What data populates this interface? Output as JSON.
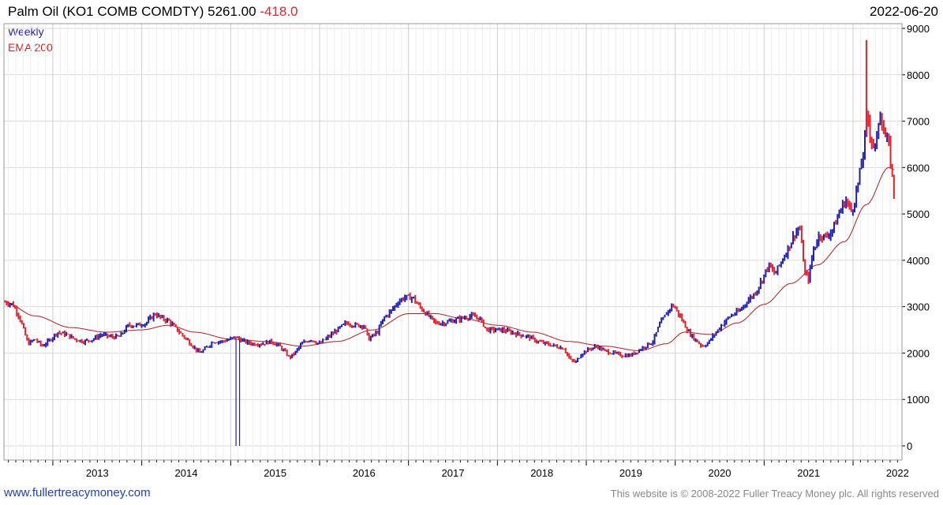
{
  "header": {
    "title": "Palm Oil (KO1 COMB COMDTY) 5261.00",
    "change": "-418.0",
    "date": "2022-06-20"
  },
  "legend": {
    "series1": "Weekly",
    "series2": "EMA 200"
  },
  "footer": {
    "left": "www.fullertreacymoney.com",
    "right": "This website is © 2008-2022 Fuller Treacy Money plc. All rights reserved"
  },
  "colors": {
    "up": "#1f1fb3",
    "down": "#e8202a",
    "ema": "#b01e22",
    "grid": "#d9d9d9",
    "axis": "#000000"
  },
  "chart_data": {
    "type": "line",
    "series_style": "weekly bar (OHLC) chart with moving average",
    "x_tick_labels": [
      "2013",
      "2014",
      "2015",
      "2016",
      "2017",
      "2018",
      "2019",
      "2020",
      "2021",
      "2022"
    ],
    "y_tick_labels": [
      "0",
      "1000",
      "2000",
      "3000",
      "4000",
      "5000",
      "6000",
      "7000",
      "8000",
      "9000"
    ],
    "ylim": [
      0,
      9000
    ],
    "xlim": [
      2012.45,
      2022.55
    ],
    "grid": true,
    "y_axis_side": "right",
    "series": [
      {
        "name": "Weekly",
        "points": [
          [
            2012.46,
            3100
          ],
          [
            2012.55,
            3050
          ],
          [
            2012.62,
            2800
          ],
          [
            2012.68,
            2450
          ],
          [
            2012.72,
            2200
          ],
          [
            2012.8,
            2300
          ],
          [
            2012.88,
            2150
          ],
          [
            2012.95,
            2250
          ],
          [
            2013.05,
            2450
          ],
          [
            2013.15,
            2400
          ],
          [
            2013.25,
            2300
          ],
          [
            2013.35,
            2250
          ],
          [
            2013.45,
            2300
          ],
          [
            2013.55,
            2400
          ],
          [
            2013.65,
            2350
          ],
          [
            2013.75,
            2350
          ],
          [
            2013.85,
            2600
          ],
          [
            2013.95,
            2600
          ],
          [
            2014.05,
            2650
          ],
          [
            2014.15,
            2850
          ],
          [
            2014.22,
            2750
          ],
          [
            2014.3,
            2700
          ],
          [
            2014.4,
            2500
          ],
          [
            2014.5,
            2300
          ],
          [
            2014.6,
            2100
          ],
          [
            2014.65,
            2000
          ],
          [
            2014.72,
            2100
          ],
          [
            2014.8,
            2250
          ],
          [
            2014.9,
            2250
          ],
          [
            2015.0,
            2300
          ],
          [
            2015.05,
            2350
          ],
          [
            2015.15,
            2250
          ],
          [
            2015.25,
            2200
          ],
          [
            2015.35,
            2200
          ],
          [
            2015.45,
            2250
          ],
          [
            2015.55,
            2150
          ],
          [
            2015.62,
            2000
          ],
          [
            2015.66,
            1900
          ],
          [
            2015.72,
            2000
          ],
          [
            2015.8,
            2200
          ],
          [
            2015.9,
            2300
          ],
          [
            2016.0,
            2200
          ],
          [
            2016.1,
            2350
          ],
          [
            2016.2,
            2500
          ],
          [
            2016.3,
            2650
          ],
          [
            2016.4,
            2600
          ],
          [
            2016.5,
            2600
          ],
          [
            2016.55,
            2300
          ],
          [
            2016.65,
            2450
          ],
          [
            2016.72,
            2750
          ],
          [
            2016.8,
            2900
          ],
          [
            2016.88,
            3100
          ],
          [
            2016.95,
            3200
          ],
          [
            2017.05,
            3200
          ],
          [
            2017.1,
            3050
          ],
          [
            2017.2,
            2850
          ],
          [
            2017.3,
            2650
          ],
          [
            2017.4,
            2650
          ],
          [
            2017.5,
            2700
          ],
          [
            2017.6,
            2750
          ],
          [
            2017.7,
            2800
          ],
          [
            2017.8,
            2750
          ],
          [
            2017.88,
            2500
          ],
          [
            2017.95,
            2500
          ],
          [
            2018.05,
            2500
          ],
          [
            2018.15,
            2450
          ],
          [
            2018.25,
            2400
          ],
          [
            2018.35,
            2350
          ],
          [
            2018.45,
            2250
          ],
          [
            2018.55,
            2200
          ],
          [
            2018.65,
            2150
          ],
          [
            2018.75,
            2100
          ],
          [
            2018.82,
            1850
          ],
          [
            2018.88,
            1800
          ],
          [
            2018.95,
            2000
          ],
          [
            2019.05,
            2100
          ],
          [
            2019.12,
            2150
          ],
          [
            2019.2,
            2050
          ],
          [
            2019.3,
            2000
          ],
          [
            2019.4,
            1950
          ],
          [
            2019.5,
            1950
          ],
          [
            2019.58,
            2050
          ],
          [
            2019.66,
            2150
          ],
          [
            2019.75,
            2250
          ],
          [
            2019.82,
            2600
          ],
          [
            2019.9,
            2850
          ],
          [
            2019.97,
            3050
          ],
          [
            2020.02,
            2900
          ],
          [
            2020.08,
            2700
          ],
          [
            2020.15,
            2450
          ],
          [
            2020.22,
            2300
          ],
          [
            2020.3,
            2150
          ],
          [
            2020.36,
            2200
          ],
          [
            2020.44,
            2400
          ],
          [
            2020.52,
            2600
          ],
          [
            2020.62,
            2800
          ],
          [
            2020.72,
            2900
          ],
          [
            2020.8,
            3100
          ],
          [
            2020.9,
            3300
          ],
          [
            2020.98,
            3600
          ],
          [
            2021.05,
            3900
          ],
          [
            2021.12,
            3700
          ],
          [
            2021.2,
            4000
          ],
          [
            2021.28,
            4300
          ],
          [
            2021.35,
            4600
          ],
          [
            2021.4,
            4700
          ],
          [
            2021.43,
            4200
          ],
          [
            2021.46,
            3700
          ],
          [
            2021.5,
            3600
          ],
          [
            2021.55,
            4200
          ],
          [
            2021.62,
            4550
          ],
          [
            2021.7,
            4500
          ],
          [
            2021.78,
            4700
          ],
          [
            2021.86,
            5100
          ],
          [
            2021.92,
            5300
          ],
          [
            2021.98,
            5050
          ],
          [
            2022.02,
            5300
          ],
          [
            2022.07,
            5800
          ],
          [
            2022.12,
            6400
          ],
          [
            2022.16,
            7200
          ],
          [
            2022.2,
            6600
          ],
          [
            2022.26,
            6400
          ],
          [
            2022.3,
            7300
          ],
          [
            2022.35,
            6700
          ],
          [
            2022.4,
            6500
          ],
          [
            2022.44,
            5800
          ],
          [
            2022.47,
            5261
          ]
        ]
      },
      {
        "name": "EMA 200",
        "points": [
          [
            2012.46,
            3100
          ],
          [
            2012.8,
            2800
          ],
          [
            2013.2,
            2550
          ],
          [
            2013.6,
            2450
          ],
          [
            2014.0,
            2500
          ],
          [
            2014.3,
            2600
          ],
          [
            2014.6,
            2450
          ],
          [
            2015.0,
            2300
          ],
          [
            2015.4,
            2250
          ],
          [
            2015.8,
            2150
          ],
          [
            2016.2,
            2250
          ],
          [
            2016.6,
            2500
          ],
          [
            2017.0,
            2850
          ],
          [
            2017.3,
            2850
          ],
          [
            2017.6,
            2750
          ],
          [
            2018.0,
            2600
          ],
          [
            2018.4,
            2450
          ],
          [
            2018.8,
            2250
          ],
          [
            2019.2,
            2150
          ],
          [
            2019.6,
            2050
          ],
          [
            2019.9,
            2200
          ],
          [
            2020.1,
            2450
          ],
          [
            2020.4,
            2400
          ],
          [
            2020.7,
            2650
          ],
          [
            2021.0,
            3050
          ],
          [
            2021.3,
            3500
          ],
          [
            2021.6,
            3900
          ],
          [
            2021.9,
            4400
          ],
          [
            2022.15,
            5200
          ],
          [
            2022.4,
            6000
          ],
          [
            2022.47,
            5950
          ]
        ]
      }
    ]
  }
}
